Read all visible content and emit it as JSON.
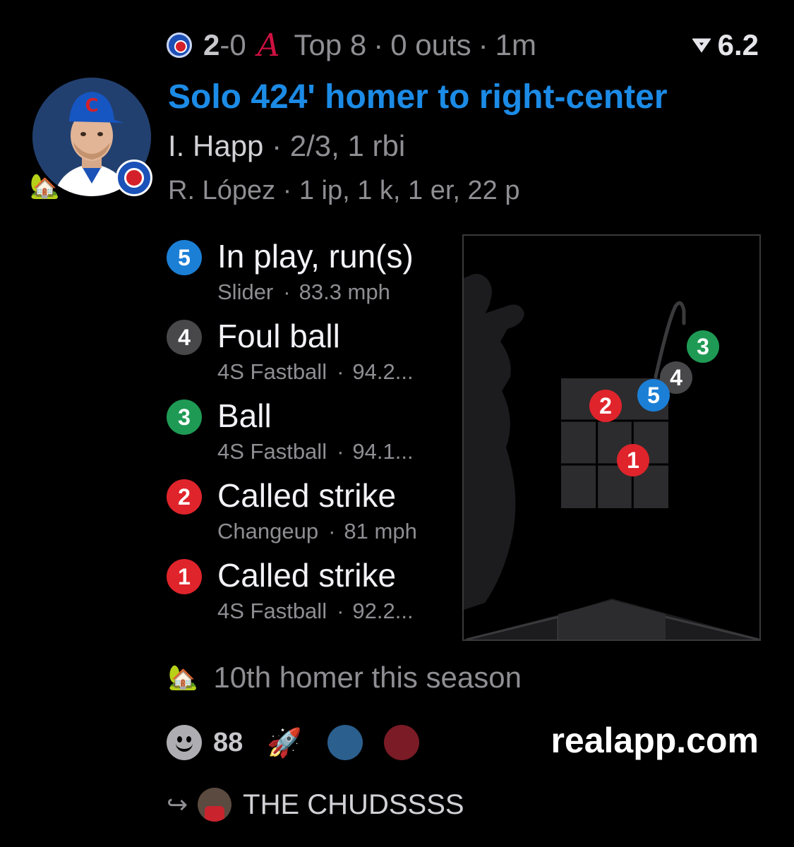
{
  "header": {
    "home_team_icon": "cubs-logo-icon",
    "score_home": "2",
    "score_sep": "-",
    "score_away": "0",
    "away_team_icon": "braves-logo-icon",
    "inning": "Top 8",
    "sep": "·",
    "outs": "0 outs",
    "time_ago": "1m",
    "rating_icon": "real-logo-icon",
    "rating": "6.2"
  },
  "play": {
    "title": "Solo 424' homer to right-center",
    "batter_name": "I. Happ",
    "batter_stats": "· 2/3, 1 rbi",
    "pitcher": "R. López · 1 ip, 1 k, 1 er, 22 p",
    "avatar_icon": "player-photo",
    "badge_icon": "cubs-badge-icon",
    "house_icon": "🏡"
  },
  "pitches": [
    {
      "number": "5",
      "result": "In play, run(s)",
      "pitch_type": "Slider",
      "sep": "·",
      "speed": "83.3 mph",
      "color": "#1c7fd6"
    },
    {
      "number": "4",
      "result": "Foul ball",
      "pitch_type": "4S Fastball",
      "sep": "·",
      "speed": "94.2...",
      "color": "#48484a"
    },
    {
      "number": "3",
      "result": "Ball",
      "pitch_type": "4S Fastball",
      "sep": "·",
      "speed": "94.1...",
      "color": "#1f9a55"
    },
    {
      "number": "2",
      "result": "Called strike",
      "pitch_type": "Changeup",
      "sep": "·",
      "speed": "81 mph",
      "color": "#e0242b"
    },
    {
      "number": "1",
      "result": "Called strike",
      "pitch_type": "4S Fastball",
      "sep": "·",
      "speed": "92.2...",
      "color": "#e0242b"
    }
  ],
  "zone": {
    "zone_color": "#2c2c2e",
    "silhouette_color": "#1c1c1e"
  },
  "footer": {
    "milestone_icon": "🏡",
    "milestone": "10th homer this season",
    "smiley_icon": "smiley-face-icon",
    "reaction_count": "88",
    "rocket_icon": "🚀",
    "circle_blue": "#2b5f8e",
    "circle_red": "#7a1b25",
    "brand": "realapp.com",
    "share_arrow": "↪",
    "shared_by": "THE CHUDSSSS"
  }
}
